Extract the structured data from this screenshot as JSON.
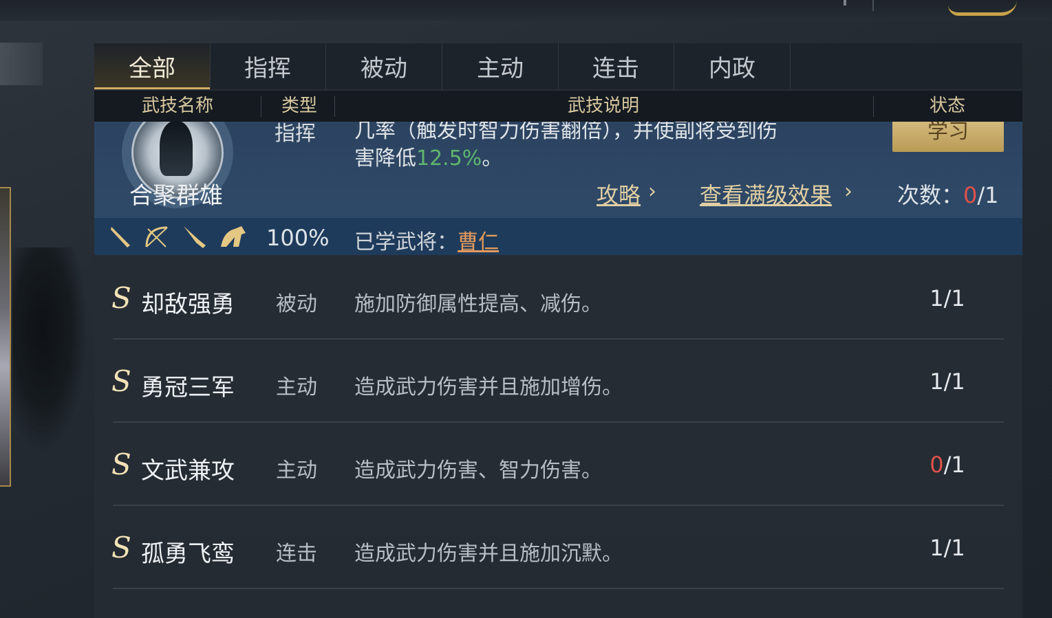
{
  "tabs": [
    {
      "label": "全部",
      "active": true
    },
    {
      "label": "指挥",
      "active": false
    },
    {
      "label": "被动",
      "active": false
    },
    {
      "label": "主动",
      "active": false
    },
    {
      "label": "连击",
      "active": false
    },
    {
      "label": "内政",
      "active": false
    }
  ],
  "columns": {
    "name": "武技名称",
    "type": "类型",
    "desc": "武技说明",
    "status": "状态"
  },
  "expanded": {
    "name": "合聚群雄",
    "type": "指挥",
    "desc_line1": "几率（触发时智力伤害翻倍），并使副将受到伤",
    "desc_line2_prefix": "害降低",
    "desc_line2_value": "12.5%",
    "desc_line2_suffix": "。",
    "learn_button": "学习",
    "guide_link": "攻略",
    "maxlevel_link": "查看满级效果",
    "count_label": "次数：",
    "count_current": "0",
    "count_total": "/1",
    "weapon_icons": [
      "sword-icon",
      "bow-icon",
      "spear-icon",
      "horse-icon"
    ],
    "success_rate": "100%",
    "learned_label": "已学武将：",
    "learned_general": "曹仁",
    "colors": {
      "highlight": "#5fb56e",
      "alert": "#e0524c",
      "link": "#e1cfa3",
      "general": "#e29a5c"
    }
  },
  "rows": [
    {
      "grade": "S",
      "name": "却敌强勇",
      "type": "被动",
      "desc": "施加防御属性提高、减伤。",
      "used": "1",
      "total": "/1",
      "used_alert": false
    },
    {
      "grade": "S",
      "name": "勇冠三军",
      "type": "主动",
      "desc": "造成武力伤害并且施加增伤。",
      "used": "1",
      "total": "/1",
      "used_alert": false
    },
    {
      "grade": "S",
      "name": "文武兼攻",
      "type": "主动",
      "desc": "造成武力伤害、智力伤害。",
      "used": "0",
      "total": "/1",
      "used_alert": true
    },
    {
      "grade": "S",
      "name": "孤勇飞鸾",
      "type": "连击",
      "desc": "造成武力伤害并且施加沉默。",
      "used": "1",
      "total": "/1",
      "used_alert": false
    }
  ]
}
